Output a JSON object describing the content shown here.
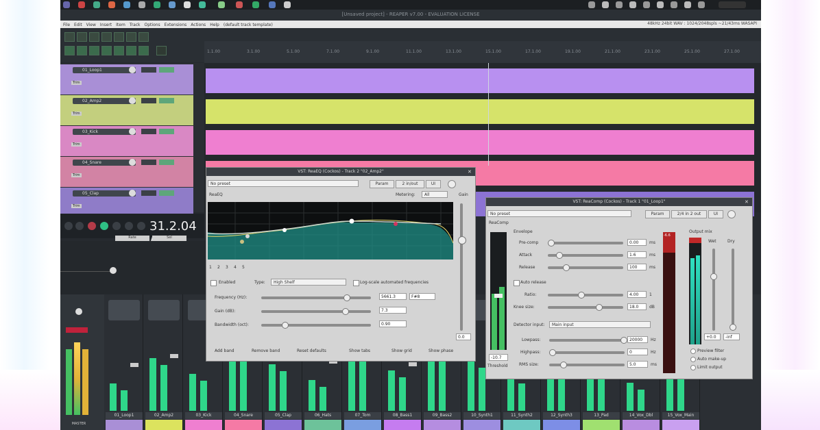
{
  "window_title": "[Unsaved project] - REAPER v7.00 - EVALUATION LICENSE",
  "menu": [
    "File",
    "Edit",
    "View",
    "Insert",
    "Item",
    "Track",
    "Options",
    "Extensions",
    "Actions",
    "Help",
    "(default track template)"
  ],
  "menu_right": "48kHz 24bit WAV : 1024/2048spls ~21/43ms WASAPI",
  "ruler_ticks": [
    "1.1.00",
    "3.1.00",
    "5.1.00",
    "7.1.00",
    "9.1.00",
    "11.1.00",
    "13.1.00",
    "15.1.00",
    "17.1.00",
    "19.1.00",
    "21.1.00",
    "23.1.00",
    "25.1.00",
    "27.1.00"
  ],
  "tracks": [
    {
      "name": "01_Loop1",
      "color": "#a98fd6",
      "lane": "#b890f0",
      "auto": "Trim"
    },
    {
      "name": "02_Amp2",
      "color": "#c3cf7e",
      "lane": "#d6e36a",
      "auto": "Trim"
    },
    {
      "name": "03_Kick",
      "color": "#d988c4",
      "lane": "#ef7fd0",
      "auto": "Trim"
    },
    {
      "name": "04_Snare",
      "color": "#d283a4",
      "lane": "#f57aa5",
      "auto": "Trim"
    },
    {
      "name": "05_Clap",
      "color": "#8f7cc8",
      "lane": "#8c73d4",
      "auto": "Trim"
    }
  ],
  "transport": {
    "time": "31.2.04 /",
    "btn_rate": "Rate",
    "btn_sel": "Sel"
  },
  "mixer_labels": [
    "01_Loop1",
    "02_Amp2",
    "03_Kick",
    "04_Snare",
    "05_Clap",
    "06_Hats",
    "07_Tom",
    "08_Bass1",
    "09_Bass2",
    "10_Synth1",
    "11_Synth2",
    "12_Synth3",
    "13_Pad",
    "14_Vox_Dbl",
    "15_Vox_Main"
  ],
  "mixer_colors": [
    "#a98fd6",
    "#dce35e",
    "#ef7fd0",
    "#f57aa5",
    "#8c73d4",
    "#6dc29a",
    "#7a9ee0",
    "#c57cf0",
    "#b58de0",
    "#9d8ee0",
    "#6ec9c2",
    "#7d8ee6",
    "#a0e070",
    "#b98de0",
    "#c9a0f0"
  ],
  "master_label": "MASTER",
  "eq": {
    "title": "VST: ReaEQ (Cockos) - Track 2 \"02_Amp2\"",
    "preset": "No preset",
    "param_btn": "Param",
    "io_btn": "2 in/out",
    "ui_btn": "UI",
    "plugin_name": "ReaEQ",
    "metering_label": "Metering:",
    "metering_value": "All",
    "gain_label": "Gain",
    "bands": [
      "1",
      "2",
      "3",
      "4",
      "5"
    ],
    "enabled_label": "Enabled",
    "type_label": "Type:",
    "type_value": "High Shelf",
    "log_label": "Log-scale automated frequencies",
    "freq_label": "Frequency (Hz):",
    "freq_value": "5661.3",
    "freq_note": "F#8",
    "gain_db_label": "Gain (dB):",
    "gain_db_value": "7.3",
    "bw_label": "Bandwidth (oct):",
    "bw_value": "0.90",
    "gain_out": "0.0",
    "bottom": [
      "Add band",
      "Remove band",
      "Reset defaults",
      "Show tabs",
      "Show grid",
      "Show phase"
    ]
  },
  "comp": {
    "title": "VST: ReaComp (Cockos) - Track 1 \"01_Loop1\"",
    "preset": "No preset",
    "param_btn": "Param",
    "io_btn": "2/4 in 2 out",
    "ui_btn": "UI",
    "plugin_name": "ReaComp",
    "envelope_label": "Envelope",
    "rows": [
      {
        "label": "Pre-comp",
        "value": "0.00",
        "unit": "ms"
      },
      {
        "label": "Attack",
        "value": "1.6",
        "unit": "ms"
      },
      {
        "label": "Release",
        "value": "100",
        "unit": "ms"
      }
    ],
    "auto_release": "Auto release",
    "ratio_label": "Ratio:",
    "ratio_value": "4.00",
    "ratio_unit": "1",
    "knee_label": "Knee size:",
    "knee_value": "18.0",
    "knee_unit": "dB",
    "detector_label": "Detector input:",
    "detector_value": "Main input",
    "lowpass_label": "Lowpass:",
    "lowpass_value": "20000",
    "lowpass_unit": "Hz",
    "highpass_label": "Highpass:",
    "highpass_value": "0",
    "highpass_unit": "Hz",
    "rms_label": "RMS size:",
    "rms_value": "5.0",
    "rms_unit": "ms",
    "threshold_label": "Threshold",
    "threshold_value": "-10.7",
    "output_mix": "Output mix",
    "wet_label": "Wet",
    "dry_label": "Dry",
    "wet_value": "+0.0",
    "dry_value": "-inf",
    "preview": "Preview filter",
    "autogain": "Auto make-up",
    "limit": "Limit output",
    "meter_top": "-6.6"
  }
}
